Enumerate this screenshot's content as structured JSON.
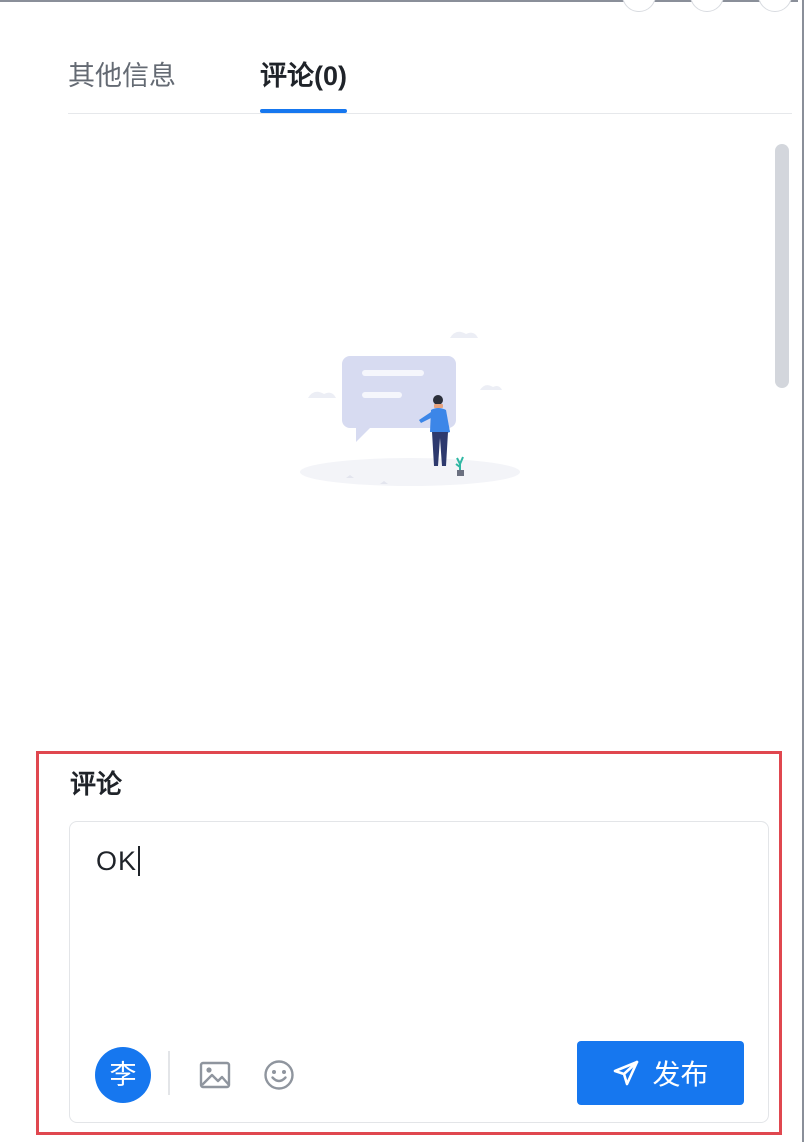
{
  "tabs": {
    "other_info": "其他信息",
    "comments": "评论(0)",
    "active": "comments"
  },
  "composer": {
    "title": "评论",
    "text": "OK",
    "avatar_initial": "李",
    "publish_label": "发布",
    "tools": [
      "image-icon",
      "emoji-icon"
    ]
  },
  "colors": {
    "accent": "#1677ef",
    "highlight_frame": "#e0474f",
    "text_primary": "#1f2329",
    "text_secondary": "#646a73"
  }
}
